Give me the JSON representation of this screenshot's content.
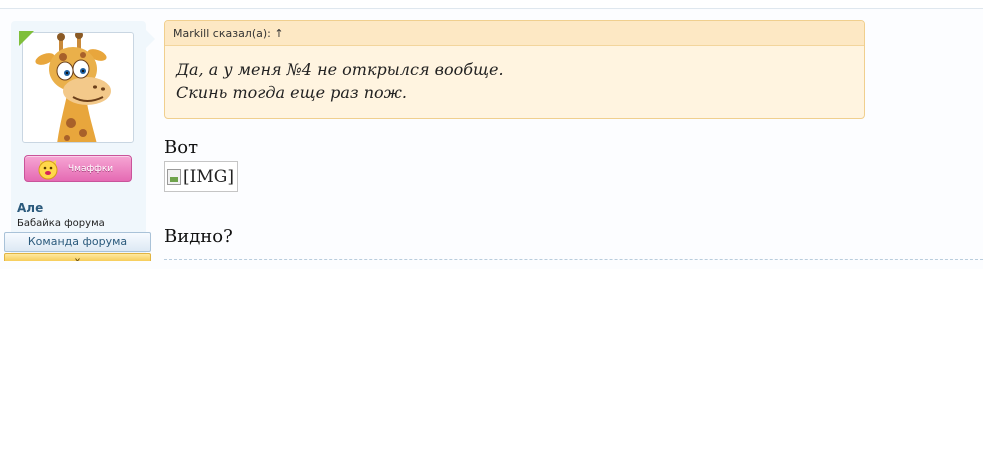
{
  "user": {
    "name": "Але",
    "title": "Бабайка форума",
    "banner": "Команда форума",
    "banner2": "х",
    "award_label": "Чмаффки",
    "avatar_icon": "giraffe-avatar",
    "online_color": "#7fbf3a"
  },
  "quote": {
    "header": "Markill сказал(а): ↑",
    "lines": [
      "Да, а у меня №4 не открылся вообще.",
      "Скинь тогда еще раз пож."
    ]
  },
  "message": {
    "line1": "Вот",
    "image_alt": "[IMG]",
    "line2": "Видно?"
  },
  "colors": {
    "quote_bg": "#fff4e0",
    "quote_border": "#f0cf8e",
    "userinfo_bg": "#f0f7fc",
    "username": "#2b5a7c"
  }
}
